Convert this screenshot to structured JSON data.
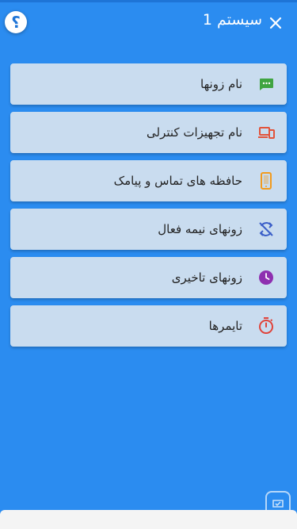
{
  "header": {
    "title": "سیستم 1",
    "help_label": "؟",
    "help_icon": "help-icon",
    "close_icon": "close-icon"
  },
  "menu": {
    "items": [
      {
        "label": "نام زونها",
        "icon": "message-icon",
        "color": "#3fa441"
      },
      {
        "label": "نام تجهیزات کنترلی",
        "icon": "devices-icon",
        "color": "#e2533b"
      },
      {
        "label": "حافظه های تماس و پیامک",
        "icon": "phone-icon",
        "color": "#f29b1d"
      },
      {
        "label": "زونهای نیمه فعال",
        "icon": "sync-disabled-icon",
        "color": "#3a5ec8"
      },
      {
        "label": "زونهای تاخیری",
        "icon": "clock-icon",
        "color": "#8e2fb0"
      },
      {
        "label": "تایمرها",
        "icon": "stopwatch-icon",
        "color": "#e0433a"
      }
    ]
  },
  "watermark": {
    "icon": "app-badge-icon"
  }
}
